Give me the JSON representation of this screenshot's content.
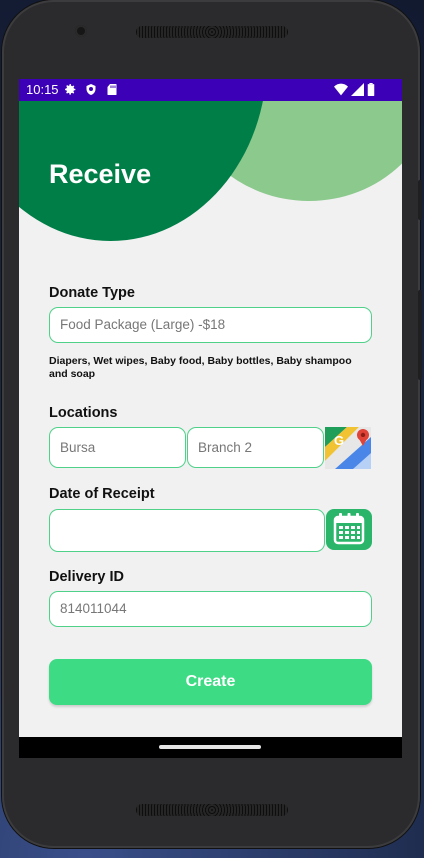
{
  "status_bar": {
    "time": "10:15"
  },
  "header": {
    "title": "Receive"
  },
  "form": {
    "donate_type": {
      "label": "Donate Type",
      "value": "Food Package (Large) -$18",
      "description": "Diapers, Wet wipes, Baby food, Baby bottles, Baby shampoo and soap"
    },
    "locations": {
      "label": "Locations",
      "city": "Bursa",
      "branch": "Branch 2"
    },
    "date_of_receipt": {
      "label": "Date of Receipt",
      "value": ""
    },
    "delivery_id": {
      "label": "Delivery ID",
      "value": "814011044"
    },
    "create_label": "Create"
  },
  "colors": {
    "status_bar": "#3c00b6",
    "header_dark_green": "#007e47",
    "header_light_green": "#8bc98d",
    "field_border": "#4fd18a",
    "button": "#3ddb84"
  }
}
